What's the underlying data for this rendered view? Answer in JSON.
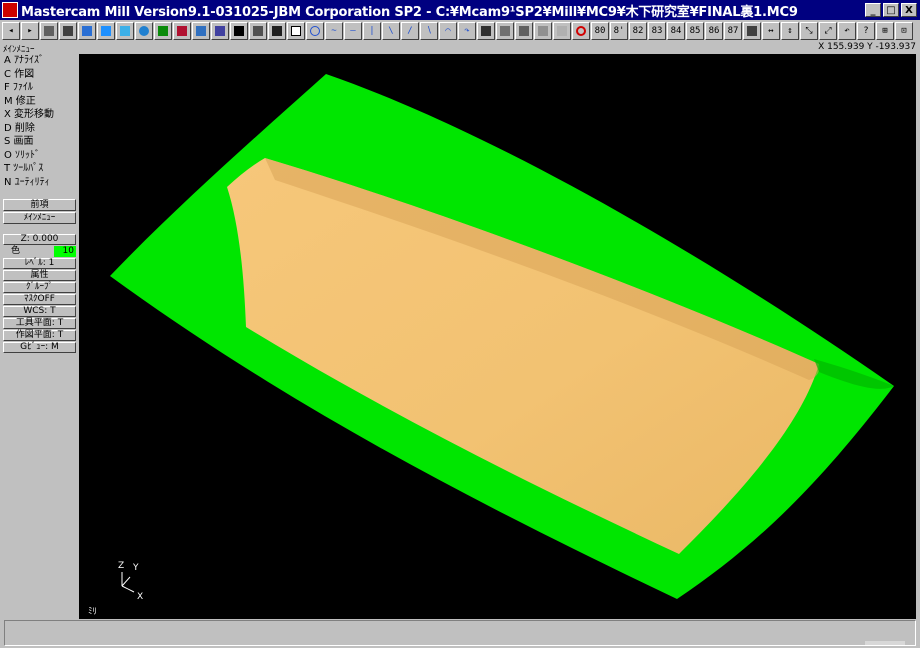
{
  "window": {
    "title": "Mastercam Mill Version9.1-031025-JBM Corporation SP2 - C:¥Mcam9¹SP2¥Mill¥MC9¥木下研究室¥FINAL裏1.MC9",
    "buttons": [
      "_",
      "□",
      "X"
    ]
  },
  "toolbar": {
    "view_buttons": [
      "80",
      "8'",
      "82",
      "83",
      "84",
      "85",
      "86",
      "87"
    ]
  },
  "status": {
    "menu_title": "ﾒｲﾝﾒﾆｭｰ",
    "coords": "X 155.939  Y -193.937"
  },
  "sidebar": {
    "menu": [
      "A ｱﾅﾗｲｽﾞ",
      "C 作図",
      "F ﾌｧｲﾙ",
      "M 修正",
      "X 変形移動",
      "D 削除",
      "S 画面",
      "O ｿﾘｯﾄﾞ",
      "T ﾂｰﾙﾊﾟｽ",
      "N ﾕｰﾃｨﾘﾃｨ"
    ],
    "nav": {
      "prev": "前項",
      "main": "ﾒｲﾝﾒﾆｭｰ"
    },
    "z_label": "Z:  0.000",
    "color_label": "色",
    "color_value": "10",
    "level": "ﾚﾍﾞﾙ: 1",
    "attribute": "属性",
    "group": "ｸﾞﾙｰﾌﾟ",
    "mask": "ﾏｽｸOFF",
    "wcs": "WCS:  T",
    "tool_plane": "工具平面:  T",
    "cons_plane": "作図平面:  T",
    "gview": "Gﾋﾞｭｰ:  M"
  },
  "viewport": {
    "axis_z": "Z",
    "axis_y": "Y",
    "axis_x": "X",
    "unit": "ﾐﾘ",
    "colors": {
      "background": "#000000",
      "outer_surface": "#00e600",
      "inner_surface": "#f2c272",
      "inner_shade": "#d9a458"
    }
  },
  "colors": {
    "titlebar": "#000080",
    "chrome": "#c0c0c0",
    "current_color_swatch": "#00ff00"
  }
}
